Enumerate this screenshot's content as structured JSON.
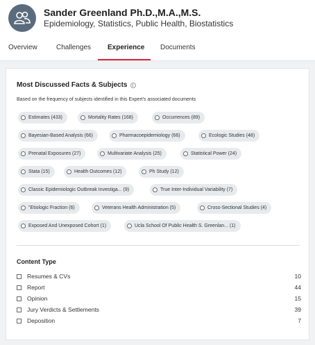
{
  "profile": {
    "name": "Sander Greenland Ph.D.,M.A.,M.S.",
    "specialties": "Epidemiology, Statistics, Public Health, Biostatistics",
    "avatar_icon": "people-icon"
  },
  "tabs": [
    {
      "label": "Overview"
    },
    {
      "label": "Challenges"
    },
    {
      "label": "Experience",
      "active": true
    },
    {
      "label": "Documents"
    }
  ],
  "accent_color": "#d9263d",
  "facts": {
    "title": "Most Discussed Facts & Subjects",
    "description": "Based on the frequency of subjects identified in this Expert's associated documents",
    "chips": [
      "Estimates (433)",
      "Mortality Rates (168)",
      "Occurrences (89)",
      "Bayesian-Based Analysis (66)",
      "Pharmacoepidemiology (66)",
      "Ecologic Studies (48)",
      "Prenatal Exposures (27)",
      "Multivariate Analysis (25)",
      "Statistical Power (24)",
      "Stata (15)",
      "Health Outcomes (12)",
      "Ph Study (12)",
      "Classic Epidemiologic Outbreak Investiga... (9)",
      "True Inter-Individual Variability (7)",
      "\"Etiologic Fraction (6)",
      "Veterans Health Administration (5)",
      "Cross-Sectional Studies (4)",
      "Exposed And Unexposed Cohort (1)",
      "Ucla School Of Public Health S. Greenlan... (1)"
    ]
  },
  "content_type": {
    "title": "Content Type",
    "items": [
      {
        "label": "Resumes & CVs",
        "count": "10"
      },
      {
        "label": "Report",
        "count": "44"
      },
      {
        "label": "Opinion",
        "count": "15"
      },
      {
        "label": "Jury Verdicts & Settlements",
        "count": "39"
      },
      {
        "label": "Deposition",
        "count": "7"
      }
    ]
  }
}
